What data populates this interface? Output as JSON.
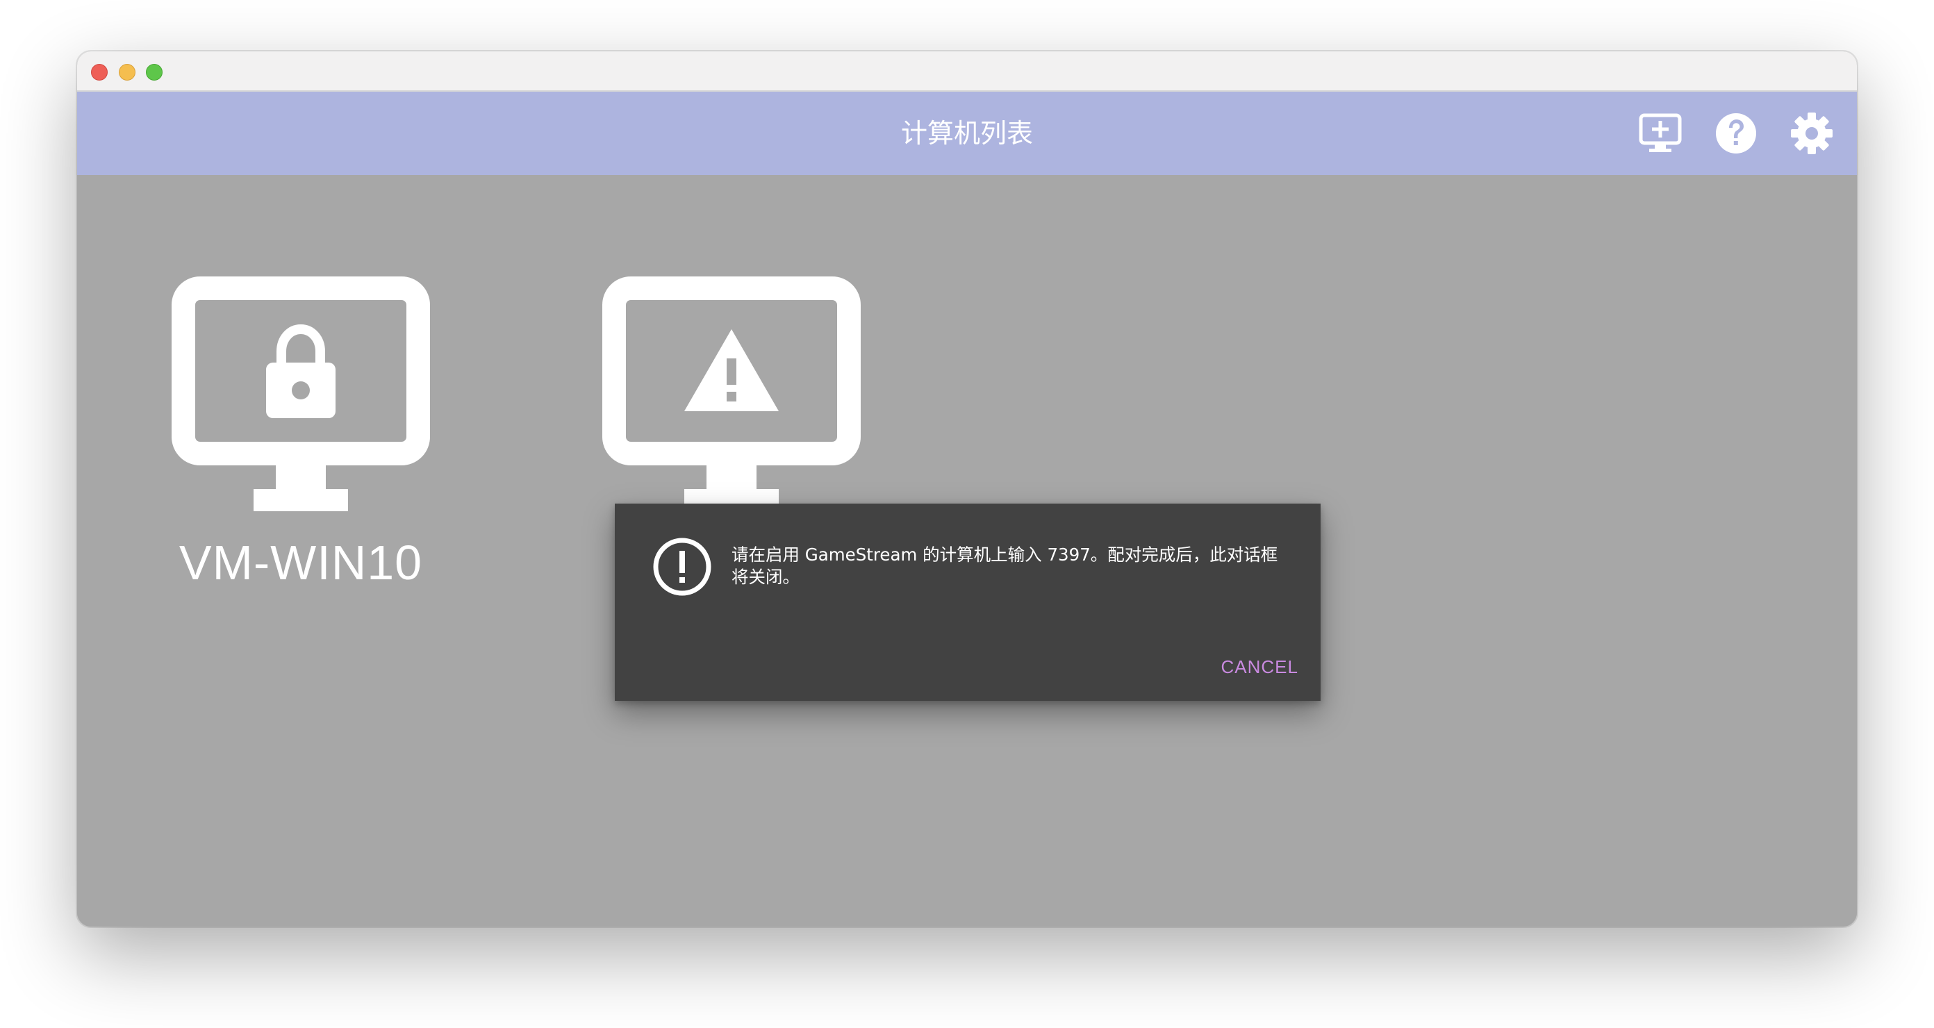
{
  "window": {
    "traffic_lights": [
      "close",
      "minimize",
      "maximize"
    ]
  },
  "appbar": {
    "title": "计算机列表",
    "actions": [
      {
        "icon": "add-computer-icon"
      },
      {
        "icon": "help-icon"
      },
      {
        "icon": "settings-gear-icon"
      }
    ]
  },
  "computers": [
    {
      "name": "VM-WIN10",
      "status_icon": "lock-icon"
    },
    {
      "name": "",
      "status_icon": "warning-icon"
    }
  ],
  "dialog": {
    "icon": "alert-circle-icon",
    "message": "请在启用 GameStream 的计算机上输入 7397。配对完成后，此对话框将关闭。",
    "cancel_label": "CANCEL"
  },
  "colors": {
    "appbar": "#adb4df",
    "content_bg": "#a7a7a7",
    "dialog_bg": "#424242",
    "accent": "#c98ae0"
  }
}
